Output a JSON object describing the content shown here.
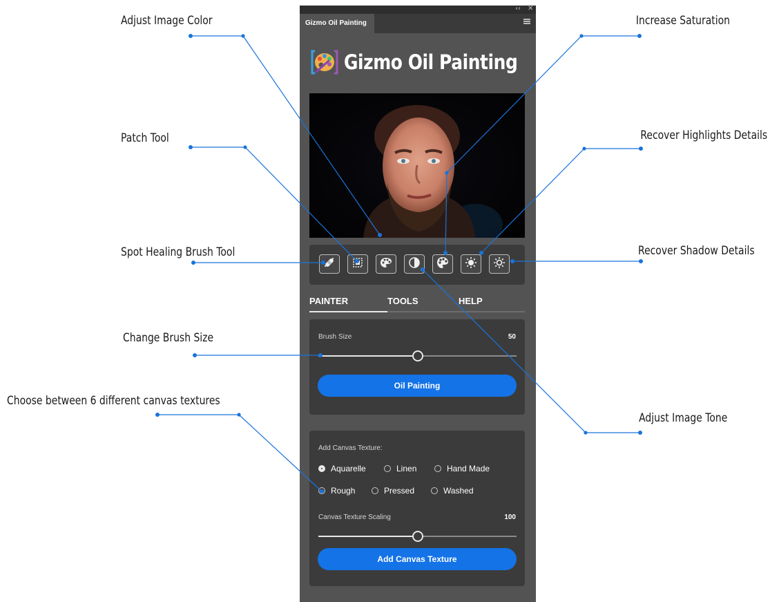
{
  "panel": {
    "tab_label": "Gizmo Oil Painting",
    "window_controls": {
      "collapse": "‹‹",
      "close": "✕"
    },
    "logo_title": "Gizmo Oil Painting",
    "tools": [
      {
        "name": "spot-healing-brush-icon"
      },
      {
        "name": "patch-tool-icon"
      },
      {
        "name": "adjust-color-icon"
      },
      {
        "name": "adjust-tone-icon"
      },
      {
        "name": "saturation-icon"
      },
      {
        "name": "highlights-icon"
      },
      {
        "name": "shadows-icon"
      }
    ],
    "tabs": {
      "painter": "PAINTER",
      "tools": "TOOLS",
      "help": "HELP",
      "active": "PAINTER"
    },
    "painter": {
      "brush_size_label": "Brush Size",
      "brush_size_value": "50",
      "brush_size_fraction": 0.5,
      "oil_painting_button": "Oil Painting"
    },
    "texture": {
      "heading": "Add Canvas Texture:",
      "options": [
        "Aquarelle",
        "Linen",
        "Hand Made",
        "Rough",
        "Pressed",
        "Washed"
      ],
      "selected": "Aquarelle",
      "scaling_label": "Canvas Texture Scaling",
      "scaling_value": "100",
      "scaling_fraction": 0.5,
      "add_button": "Add Canvas Texture"
    },
    "accent_color": "#1473e6"
  },
  "callouts": {
    "adjust_image_color": "Adjust Image Color",
    "patch_tool": "Patch Tool",
    "spot_healing": "Spot Healing Brush Tool",
    "change_brush_size": "Change Brush Size",
    "canvas_textures": "Choose between 6 different canvas textures",
    "increase_saturation": "Increase Saturation",
    "recover_highlights": "Recover Highlights Details",
    "recover_shadows": "Recover Shadow Details",
    "adjust_image_tone": "Adjust Image Tone"
  },
  "callout_color": "#1a73d9"
}
